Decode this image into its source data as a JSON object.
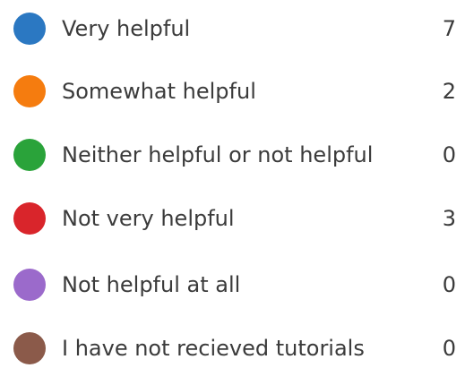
{
  "legend": {
    "items": [
      {
        "label": "Very helpful",
        "count": "7",
        "color": "#2b78c2"
      },
      {
        "label": "Somewhat helpful",
        "count": "2",
        "color": "#f57c0f"
      },
      {
        "label": "Neither helpful or not helpful",
        "count": "0",
        "color": "#2aa33a"
      },
      {
        "label": "Not very helpful",
        "count": "3",
        "color": "#d9252b"
      },
      {
        "label": "Not helpful at all",
        "count": "0",
        "color": "#9b6acb"
      },
      {
        "label": "I have not recieved tutorials",
        "count": "0",
        "color": "#8b5a4a"
      }
    ]
  }
}
